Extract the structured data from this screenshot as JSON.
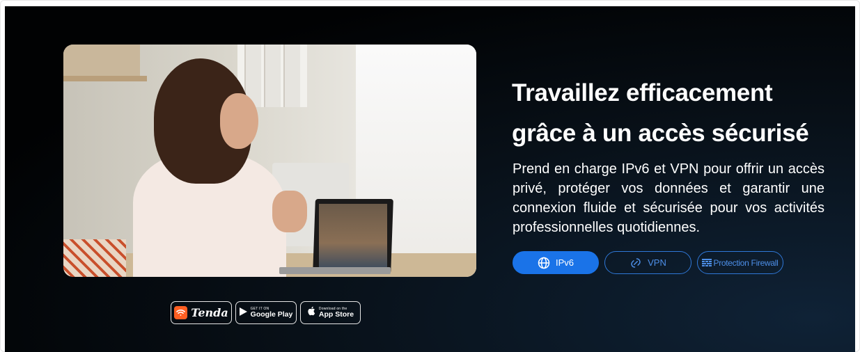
{
  "hero": {
    "headline_line1": "Travaillez efficacement",
    "headline_line2": "grâce à un accès sécurisé",
    "description": "Prend en charge IPv6 et VPN pour offrir un accès privé, protéger vos données et garantir une connexion fluide et sécurisée pour vos activités professionnelles quotidiennes."
  },
  "features": [
    {
      "label": "IPv6",
      "icon": "globe-icon",
      "style": "primary"
    },
    {
      "label": "VPN",
      "icon": "vpn-icon",
      "style": "outline"
    },
    {
      "label": "Protection Firewall",
      "icon": "firewall-icon",
      "style": "outline"
    }
  ],
  "stores": {
    "tenda": {
      "label": "Tenda",
      "icon": "tenda-wifi-icon"
    },
    "google_play": {
      "small": "GET IT ON",
      "big": "Google Play",
      "icon": "google-play-icon"
    },
    "app_store": {
      "small": "Download on the",
      "big": "App Store",
      "icon": "apple-icon"
    }
  },
  "colors": {
    "background": "#010203",
    "accent": "#1a73e8",
    "outline": "#2f78d8",
    "tenda_orange": "#ff5f22"
  }
}
